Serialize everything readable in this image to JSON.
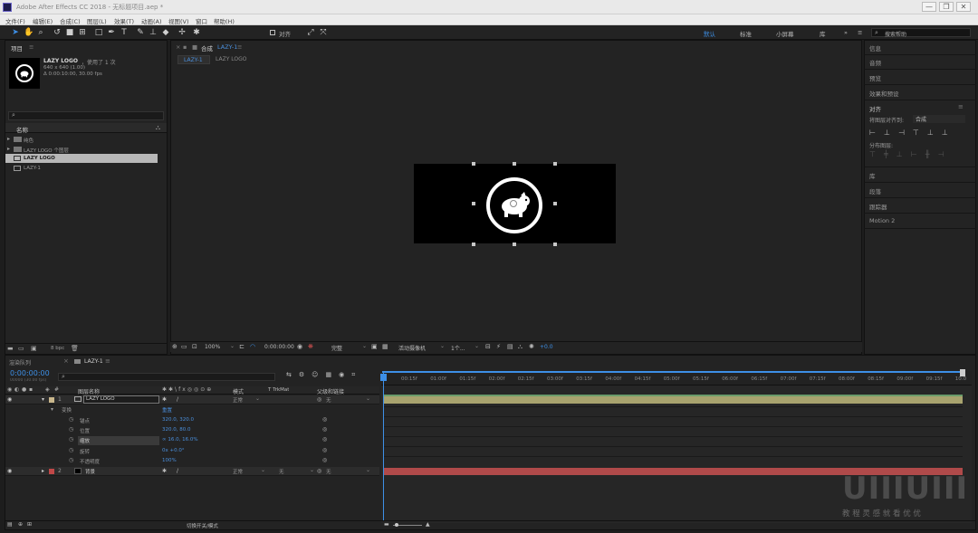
{
  "window": {
    "title": "Adobe After Effects CC 2018 - 无标题项目.aep *",
    "controls": [
      "—",
      "❐",
      "✕"
    ]
  },
  "menu": [
    "文件(F)",
    "编辑(E)",
    "合成(C)",
    "图层(L)",
    "效果(T)",
    "动画(A)",
    "视图(V)",
    "窗口",
    "帮助(H)"
  ],
  "toolbar": {
    "snap_label": "对齐",
    "workspaces": [
      "默认",
      "标准",
      "小屏幕",
      "库"
    ],
    "search_placeholder": "搜索帮助"
  },
  "project": {
    "title": "项目",
    "item_name": "LAZY LOGO",
    "item_used": "，使用了 1 次",
    "item_dims": "640 x 640 (1.00)",
    "item_duration": "Δ 0:00:10:00, 30.00 fps",
    "column_name": "名称",
    "items": [
      {
        "type": "folder",
        "label": "纯色"
      },
      {
        "type": "folder",
        "label": "LAZY LOGO 个图层"
      },
      {
        "type": "comp",
        "label": "LAZY LOGO"
      },
      {
        "type": "comp",
        "label": "LAZY-1"
      }
    ],
    "bpc": "8 bpc"
  },
  "composition": {
    "panel_title": "合成",
    "comp_name": "LAZY-1",
    "tabs": [
      "LAZY-1",
      "LAZY LOGO"
    ],
    "zoom": "100%",
    "timecode": "0:00:00:00",
    "resolution": "完整",
    "camera": "活动摄像机",
    "views": "1个...",
    "exposure": "+0.0"
  },
  "right_panels": {
    "items_top": [
      "信息",
      "音频",
      "预览",
      "效果和预设"
    ],
    "align_title": "对齐",
    "align_to_label": "将图层对齐到:",
    "align_to_value": "合成",
    "distribute_label": "分布图层:",
    "items_bottom": [
      "库",
      "段落",
      "跟踪器",
      "Motion 2"
    ]
  },
  "timeline": {
    "render_queue_tab": "渲染队列",
    "comp_tab": "LAZY-1",
    "timecode": "0:00:00:00",
    "frame_info": "00000 (30.00 fps)",
    "columns": {
      "name": "图层名称",
      "mode": "模式",
      "trkmat": "T TrkMat",
      "parent": "父级和链接"
    },
    "ruler": [
      "00:15f",
      "01:00f",
      "01:15f",
      "02:00f",
      "02:15f",
      "03:00f",
      "03:15f",
      "04:00f",
      "04:15f",
      "05:00f",
      "05:15f",
      "06:00f",
      "06:15f",
      "07:00f",
      "07:15f",
      "08:00f",
      "08:15f",
      "09:00f",
      "09:15f",
      "10:0"
    ],
    "layers": [
      {
        "index": "1",
        "name": "LAZY LOGO",
        "mode": "正常",
        "parent": "无"
      },
      {
        "index": "2",
        "name": "背景",
        "mode": "正常",
        "trkmat": "无",
        "parent": "无"
      }
    ],
    "transform_label": "变换",
    "transform_reset": "重置",
    "properties": [
      {
        "name": "锚点",
        "value": "320.0, 320.0"
      },
      {
        "name": "位置",
        "value": "320.0, 80.0"
      },
      {
        "name": "缩放",
        "value": "∞ 16.0, 16.0%"
      },
      {
        "name": "旋转",
        "value": "0x +0.0°"
      },
      {
        "name": "不透明度",
        "value": "100%"
      }
    ],
    "footer_label": "切换开关/模式"
  },
  "watermark": {
    "logo": "UIIIUIII",
    "tagline": "教 程 灵 感 就 看 优 优"
  }
}
